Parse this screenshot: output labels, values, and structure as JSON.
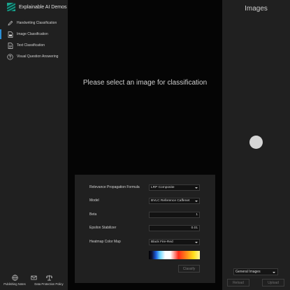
{
  "app": {
    "title": "Explainable AI Demos"
  },
  "sidebar": {
    "items": [
      {
        "label": "Handwriting Classification",
        "icon": "pencil-icon",
        "active": false
      },
      {
        "label": "Image Classification",
        "icon": "image-file-icon",
        "active": true
      },
      {
        "label": "Text Classification",
        "icon": "text-file-icon",
        "active": false
      },
      {
        "label": "Visual Question Answering",
        "icon": "question-circle-icon",
        "active": false
      }
    ],
    "footer": [
      {
        "label": "Publishing Notes",
        "icon": "globe-icon"
      },
      {
        "label": "Data Protection Policy",
        "icon": "scales-icon"
      }
    ],
    "footer_middle_icon": "mail-icon"
  },
  "main": {
    "prompt": "Please select an image for classification"
  },
  "panel": {
    "rows": [
      {
        "label": "Relevance Propagation Formula",
        "value": "LRP Composite",
        "kind": "select"
      },
      {
        "label": "Model",
        "value": "BVLC Reference Caffenet",
        "kind": "select"
      },
      {
        "label": "Beta",
        "value": "1",
        "kind": "number"
      },
      {
        "label": "Epsilon Stabilizer",
        "value": "0.01",
        "kind": "number"
      },
      {
        "label": "Heatmap Color Map",
        "value": "Black Fire-Red",
        "kind": "select"
      }
    ],
    "colormap": "black-fire-red gradient",
    "classify_label": "Classify"
  },
  "right": {
    "title": "Images",
    "loading": true,
    "select_value": "General Images",
    "reload_label": "Reload",
    "upload_label": "Upload"
  },
  "colors": {
    "sidebar_bg": "#202020",
    "main_bg": "#050505",
    "accent": "#2b8fd6",
    "logo": "#1aa58e"
  }
}
